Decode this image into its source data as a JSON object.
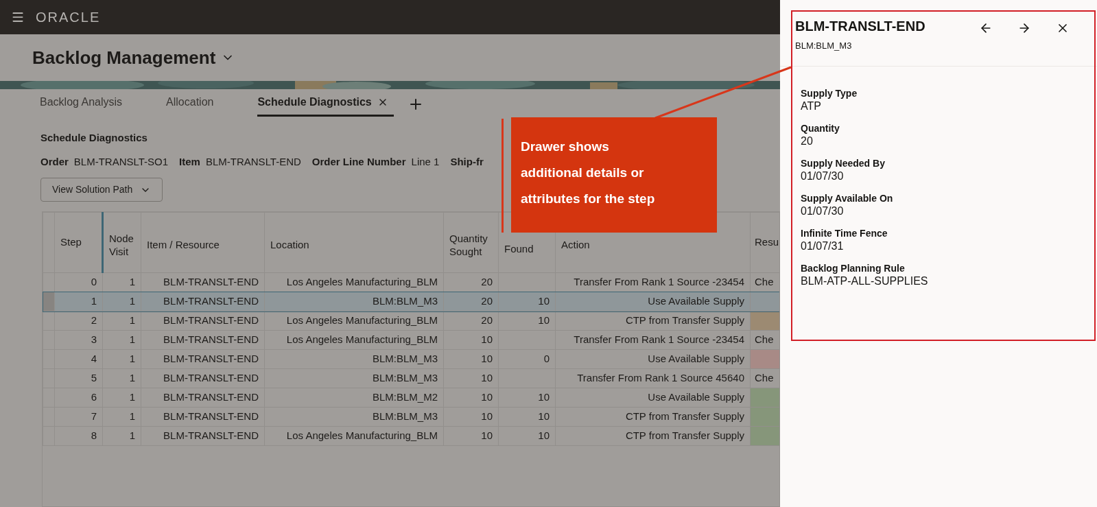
{
  "header": {
    "logo": "ORACLE"
  },
  "page_title": "Backlog Management",
  "tabs": [
    {
      "label": "Backlog Analysis",
      "selected": false,
      "closable": false
    },
    {
      "label": "Allocation",
      "selected": false,
      "closable": false
    },
    {
      "label": "Schedule Diagnostics",
      "selected": true,
      "closable": true
    }
  ],
  "section_title": "Schedule Diagnostics",
  "order_info": [
    {
      "label": "Order",
      "value": "BLM-TRANSLT-SO1"
    },
    {
      "label": "Item",
      "value": "BLM-TRANSLT-END"
    },
    {
      "label": "Order Line Number",
      "value": "Line 1"
    },
    {
      "label": "Ship-fr"
    }
  ],
  "view_button": "View Solution Path",
  "table": {
    "columns": [
      "Step",
      "Node Visit",
      "Item / Resource",
      "Location",
      "Quantity Sought",
      "Found",
      "Action",
      "Resu"
    ],
    "rows": [
      {
        "step": "0",
        "node_visit": "1",
        "item": "BLM-TRANSLT-END",
        "location": "Los Angeles Manufacturing_BLM",
        "sought": "20",
        "action": "Transfer From Rank 1 Source -23454",
        "result": "Che",
        "selected": false
      },
      {
        "step": "1",
        "node_visit": "1",
        "item": "BLM-TRANSLT-END",
        "location": "BLM:BLM_M3",
        "sought": "20",
        "found": "10",
        "action": "Use Available Supply",
        "selected": true
      },
      {
        "step": "2",
        "node_visit": "1",
        "item": "BLM-TRANSLT-END",
        "location": "Los Angeles Manufacturing_BLM",
        "sought": "20",
        "found": "10",
        "action": "CTP from Transfer Supply",
        "color": "#9c8a72",
        "selected": false
      },
      {
        "step": "3",
        "node_visit": "1",
        "item": "BLM-TRANSLT-END",
        "location": "Los Angeles Manufacturing_BLM",
        "sought": "10",
        "action": "Transfer From Rank 1 Source -23454",
        "result": "Che",
        "selected": false
      },
      {
        "step": "4",
        "node_visit": "1",
        "item": "BLM-TRANSLT-END",
        "location": "BLM:BLM_M3",
        "sought": "10",
        "found": "0",
        "action": "Use Available Supply",
        "color": "#a88a86",
        "selected": false
      },
      {
        "step": "5",
        "node_visit": "1",
        "item": "BLM-TRANSLT-END",
        "location": "BLM:BLM_M3",
        "sought": "10",
        "action": "Transfer From Rank 1 Source 45640",
        "result": "Che",
        "selected": false
      },
      {
        "step": "6",
        "node_visit": "1",
        "item": "BLM-TRANSLT-END",
        "location": "BLM:BLM_M2",
        "sought": "10",
        "found": "10",
        "action": "Use Available Supply",
        "color": "#86967a",
        "selected": false
      },
      {
        "step": "7",
        "node_visit": "1",
        "item": "BLM-TRANSLT-END",
        "location": "BLM:BLM_M3",
        "sought": "10",
        "found": "10",
        "action": "CTP from Transfer Supply",
        "color": "#86967a",
        "selected": false
      },
      {
        "step": "8",
        "node_visit": "1",
        "item": "BLM-TRANSLT-END",
        "location": "Los Angeles Manufacturing_BLM",
        "sought": "10",
        "found": "10",
        "action": "CTP from Transfer Supply",
        "color": "#86967a",
        "selected": false
      }
    ]
  },
  "callout": {
    "lines": [
      "Drawer shows",
      "additional details  or",
      "attributes for the step"
    ]
  },
  "drawer": {
    "title": "BLM-TRANSLT-END",
    "subtitle": "BLM:BLM_M3",
    "fields": [
      {
        "label": "Supply Type",
        "value": "ATP"
      },
      {
        "label": "Quantity",
        "value": "20"
      },
      {
        "label": "Supply Needed By",
        "value": "01/07/30"
      },
      {
        "label": "Supply Available On",
        "value": "01/07/30"
      },
      {
        "label": "Infinite Time Fence",
        "value": "01/07/31"
      },
      {
        "label": "Backlog Planning Rule",
        "value": "BLM-ATP-ALL-SUPPLIES"
      }
    ]
  }
}
